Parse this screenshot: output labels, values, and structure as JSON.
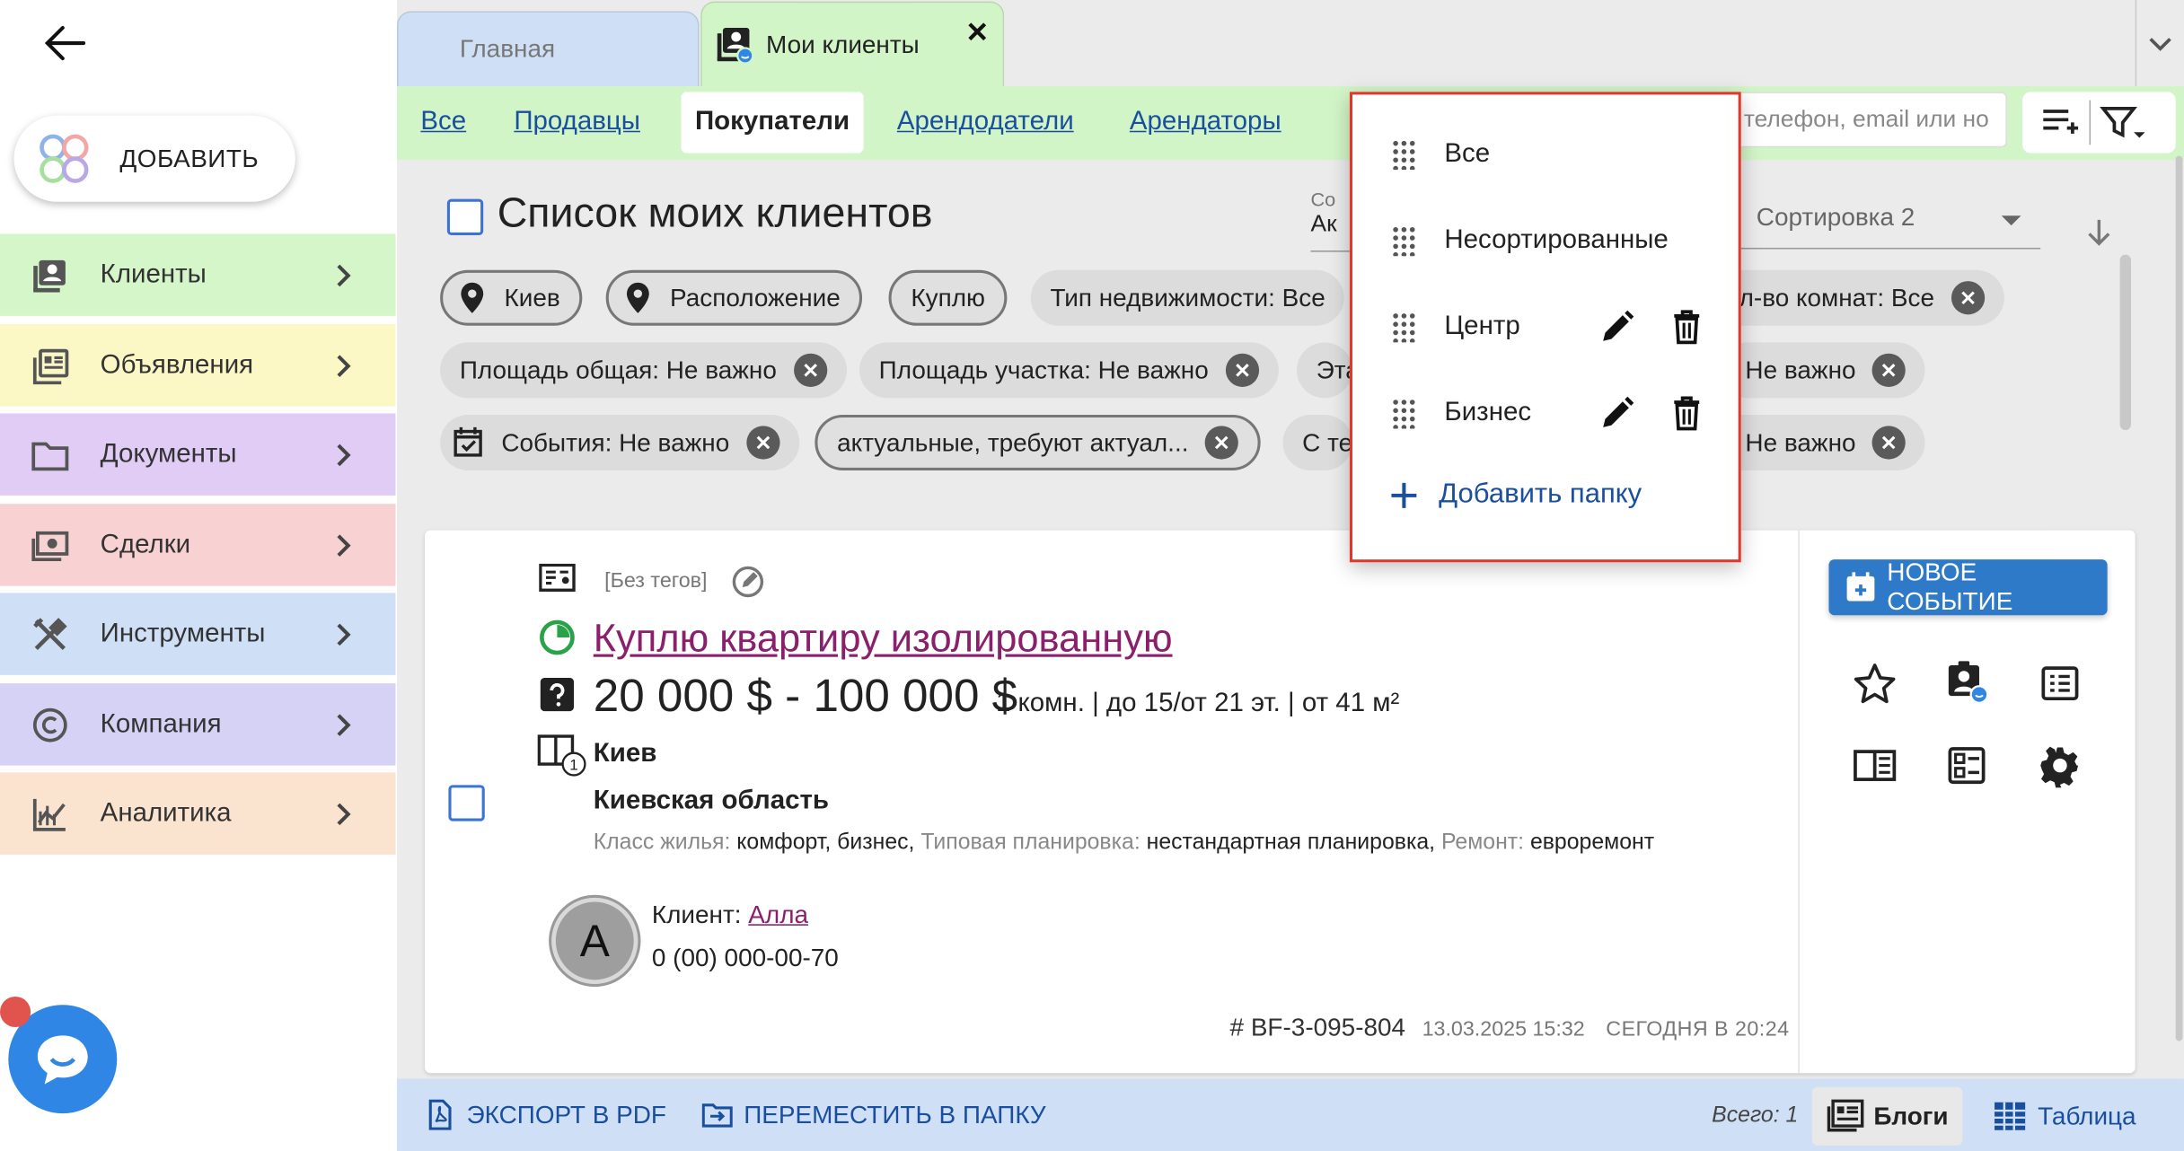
{
  "sidebar": {
    "add_label": "ДОБАВИТЬ",
    "items": [
      {
        "label": "Клиенты",
        "icon": "clients-icon",
        "color": "#d4f6c9"
      },
      {
        "label": "Объявления",
        "icon": "listings-icon",
        "color": "#fbf8c6"
      },
      {
        "label": "Документы",
        "icon": "folder-icon",
        "color": "#e1ccf6"
      },
      {
        "label": "Сделки",
        "icon": "deals-icon",
        "color": "#f8d2d3"
      },
      {
        "label": "Инструменты",
        "icon": "tools-icon",
        "color": "#cfe0f6"
      },
      {
        "label": "Компания",
        "icon": "copyright-icon",
        "color": "#d6d2f6"
      },
      {
        "label": "Аналитика",
        "icon": "analytics-icon",
        "color": "#fae3cf"
      }
    ]
  },
  "tabs": {
    "home": "Главная",
    "clients": "Мои клиенты"
  },
  "filter_tabs": [
    "Все",
    "Продавцы",
    "Покупатели",
    "Арендодатели",
    "Арендаторы"
  ],
  "active_filter_tab": "Покупатели",
  "search": {
    "placeholder": "телефон, email или но"
  },
  "list": {
    "title": "Список моих клиентов",
    "sort1_label": "Со",
    "sort1_value": "Ак",
    "sort2_label": "Сортировка 2"
  },
  "chips": {
    "row1": [
      "Киев",
      "Расположение",
      "Куплю",
      "Тип недвижимости: Все",
      "ол-во комнат: Все"
    ],
    "row2": [
      "Площадь общая: Не важно",
      "Площадь участка: Не важно",
      "Эта",
      "Не важно"
    ],
    "row3": [
      "События: Не важно",
      "актуальные, требуют актуал...",
      "С те",
      ": Не важно"
    ]
  },
  "card": {
    "tags": "[Без тегов]",
    "title": "Куплю квартиру изолированную",
    "price": "20 000 $ - 100 000 $",
    "price_extra": "1 комн. | до 15/от 21 эт. | от 41 м²",
    "city": "Киев",
    "region": "Киевская область",
    "attrs": {
      "k1": "Класс жилья:",
      "v1": "комфорт, бизнес,",
      "k2": "Типовая планировка:",
      "v2": "нестандартная планировка,",
      "k3": "Ремонт:",
      "v3": "евроремонт"
    },
    "avatar_letter": "А",
    "client_label": "Клиент:",
    "client_name": "Алла",
    "phone": "0 (00) 000-00-70",
    "id": "# BF-3-095-804",
    "created": "13.03.2025 15:32",
    "updated": "СЕГОДНЯ В 20:24",
    "new_event": "НОВОЕ СОБЫТИЕ",
    "doc_badge": "1"
  },
  "bottom": {
    "export": "ЭКСПОРТ В PDF",
    "move": "ПЕРЕМЕСТИТЬ В ПАПКУ",
    "total": "Всего: 1",
    "blogs": "Блоги",
    "table": "Таблица"
  },
  "folders": {
    "items": [
      {
        "label": "Все",
        "editable": false
      },
      {
        "label": "Несортированные",
        "editable": false
      },
      {
        "label": "Центр",
        "editable": true
      },
      {
        "label": "Бизнес",
        "editable": true
      }
    ],
    "add_label": "Добавить папку"
  },
  "colors": {
    "accent": "#1a4fa0",
    "tab_green": "#d2f5c7",
    "popup_border": "#e0392c",
    "link_purple": "#8a1f6b",
    "button_blue": "#2f7ac8"
  }
}
